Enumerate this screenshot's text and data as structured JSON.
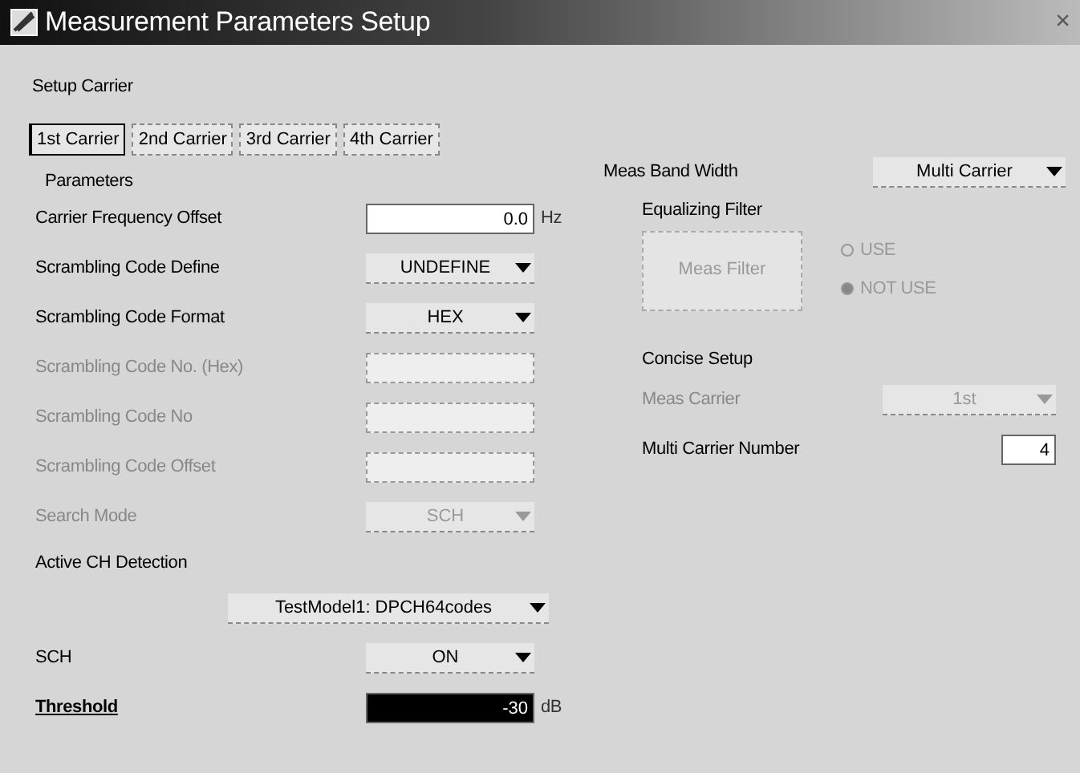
{
  "window": {
    "title": "Measurement Parameters Setup",
    "close": "×"
  },
  "setup_carrier": "Setup Carrier",
  "carrier_tabs": [
    {
      "label": "1st Carrier",
      "selected": true
    },
    {
      "label": "2nd Carrier",
      "selected": false
    },
    {
      "label": "3rd Carrier",
      "selected": false
    },
    {
      "label": "4th Carrier",
      "selected": false
    }
  ],
  "parameters": {
    "title": "Parameters",
    "rows": [
      {
        "kind": "input",
        "label": "Carrier Frequency Offset",
        "value": "0.0",
        "unit": "Hz",
        "disabled": false,
        "focused": false
      },
      {
        "kind": "select",
        "label": "Scrambling Code Define",
        "value": "UNDEFINE",
        "disabled": false
      },
      {
        "kind": "select",
        "label": "Scrambling Code Format",
        "value": "HEX",
        "disabled": false
      },
      {
        "kind": "input",
        "label": "Scrambling Code No. (Hex)",
        "disabled": true,
        "focused": false
      },
      {
        "kind": "input",
        "label": "Scrambling Code No",
        "disabled": true,
        "focused": false
      },
      {
        "kind": "input",
        "label": "Scrambling Code Offset",
        "disabled": true,
        "focused": false
      },
      {
        "kind": "select",
        "label": "Search Mode",
        "value": "SCH",
        "disabled": true
      },
      {
        "kind": "heading",
        "label": "Active CH Detection"
      },
      {
        "kind": "wideselect",
        "value": "TestModel1: DPCH64codes",
        "disabled": false
      },
      {
        "kind": "select",
        "label": "SCH",
        "value": "ON",
        "disabled": false
      },
      {
        "kind": "input",
        "label": "Threshold",
        "value": "-30",
        "unit": "dB",
        "disabled": false,
        "focused": true
      }
    ]
  },
  "meas_band_width": {
    "label": "Meas Band Width",
    "value": "Multi Carrier"
  },
  "equalizing_filter": {
    "title": "Equalizing Filter",
    "button": {
      "label": "Meas Filter",
      "disabled": true
    },
    "options": [
      {
        "label": "USE",
        "selected": false,
        "disabled": true
      },
      {
        "label": "NOT USE",
        "selected": true,
        "disabled": true
      }
    ]
  },
  "concise_setup": {
    "title": "Concise Setup",
    "rows": [
      {
        "kind": "select",
        "label": "Meas Carrier",
        "value": "1st",
        "disabled": true
      },
      {
        "kind": "input",
        "label": "Multi Carrier Number",
        "value": "4",
        "disabled": false,
        "focused": false
      }
    ]
  }
}
